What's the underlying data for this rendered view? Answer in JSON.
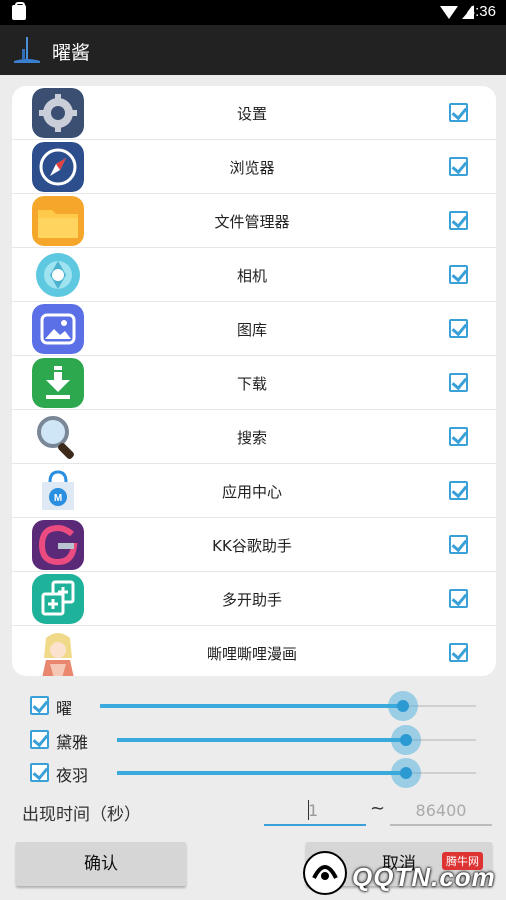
{
  "status_bar": {
    "time": "4:36"
  },
  "app_bar": {
    "title": "曜酱"
  },
  "apps": [
    {
      "name": "设置",
      "checked": true,
      "icon": "settings-icon"
    },
    {
      "name": "浏览器",
      "checked": true,
      "icon": "browser-icon"
    },
    {
      "name": "文件管理器",
      "checked": true,
      "icon": "file-manager-icon"
    },
    {
      "name": "相机",
      "checked": true,
      "icon": "camera-icon"
    },
    {
      "name": "图库",
      "checked": true,
      "icon": "gallery-icon"
    },
    {
      "name": "下载",
      "checked": true,
      "icon": "download-icon"
    },
    {
      "name": "搜索",
      "checked": true,
      "icon": "search-icon"
    },
    {
      "name": "应用中心",
      "checked": true,
      "icon": "app-center-icon"
    },
    {
      "name": "KK谷歌助手",
      "checked": true,
      "icon": "google-helper-icon"
    },
    {
      "name": "多开助手",
      "checked": true,
      "icon": "multi-open-icon"
    },
    {
      "name": "嘶哩嘶哩漫画",
      "checked": true,
      "icon": "comic-icon"
    }
  ],
  "characters": [
    {
      "label": "曜",
      "checked": true
    },
    {
      "label": "黛雅",
      "checked": true
    },
    {
      "label": "夜羽",
      "checked": true
    }
  ],
  "appear_time": {
    "label": "出现时间（秒）",
    "min_value": "1",
    "separator": "~",
    "max_placeholder": "86400"
  },
  "buttons": {
    "confirm": "确认",
    "cancel": "取消"
  },
  "watermark": {
    "text": "QQTN.com",
    "sub": "腾牛网"
  },
  "colors": {
    "accent": "#3aa9dc",
    "appbar": "#222222",
    "status": "#000000"
  }
}
